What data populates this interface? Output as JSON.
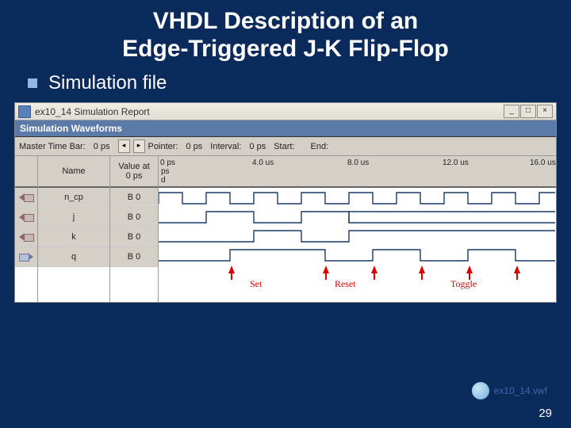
{
  "slide": {
    "title_line1": "VHDL Description of an",
    "title_line2": "Edge-Triggered J-K Flip-Flop",
    "subtitle": "Simulation file",
    "page_number": "29"
  },
  "window": {
    "title": "ex10_14 Simulation Report",
    "band": "Simulation Waveforms"
  },
  "toolbar": {
    "master_time_bar_label": "Master Time Bar:",
    "master_time_bar_value": "0 ps",
    "pointer_label": "Pointer:",
    "pointer_value": "0 ps",
    "interval_label": "Interval:",
    "interval_value": "0 ps",
    "start_label": "Start:",
    "start_value": "",
    "end_label": "End:",
    "end_value": ""
  },
  "columns": {
    "name_header": "Name",
    "value_header_l1": "Value at",
    "value_header_l2": "0 ps"
  },
  "ruler": {
    "ticks": [
      "0 ps",
      "4.0 us",
      "8.0 us",
      "12.0 us",
      "16.0 us"
    ],
    "sub_l1": "ps",
    "sub_l2": "d"
  },
  "signals": [
    {
      "name": "n_cp",
      "value": "B 0",
      "dir": "in"
    },
    {
      "name": "j",
      "value": "B 0",
      "dir": "in"
    },
    {
      "name": "k",
      "value": "B 0",
      "dir": "in"
    },
    {
      "name": "q",
      "value": "B 0",
      "dir": "out"
    }
  ],
  "annotations": {
    "set": "Set",
    "reset": "Reset",
    "toggle": "Toggle"
  },
  "footer_file": "ex10_14.vwf",
  "chart_data": {
    "type": "digital-timing",
    "time_unit": "us",
    "time_range": [
      0,
      16
    ],
    "signals": {
      "n_cp": {
        "period_us": 2.0,
        "duty": 0.5,
        "initial": 0
      },
      "j": {
        "edges_us": [
          0,
          2,
          4,
          6,
          8,
          16
        ],
        "levels": [
          0,
          1,
          0,
          1,
          0,
          1
        ]
      },
      "k": {
        "edges_us": [
          0,
          4,
          6,
          8,
          16
        ],
        "levels": [
          0,
          0,
          1,
          0,
          1
        ]
      },
      "q": {
        "edges_us": [
          0,
          3,
          7,
          9,
          11,
          13,
          15,
          16
        ],
        "levels": [
          0,
          1,
          0,
          1,
          0,
          1,
          0,
          1
        ]
      }
    }
  }
}
